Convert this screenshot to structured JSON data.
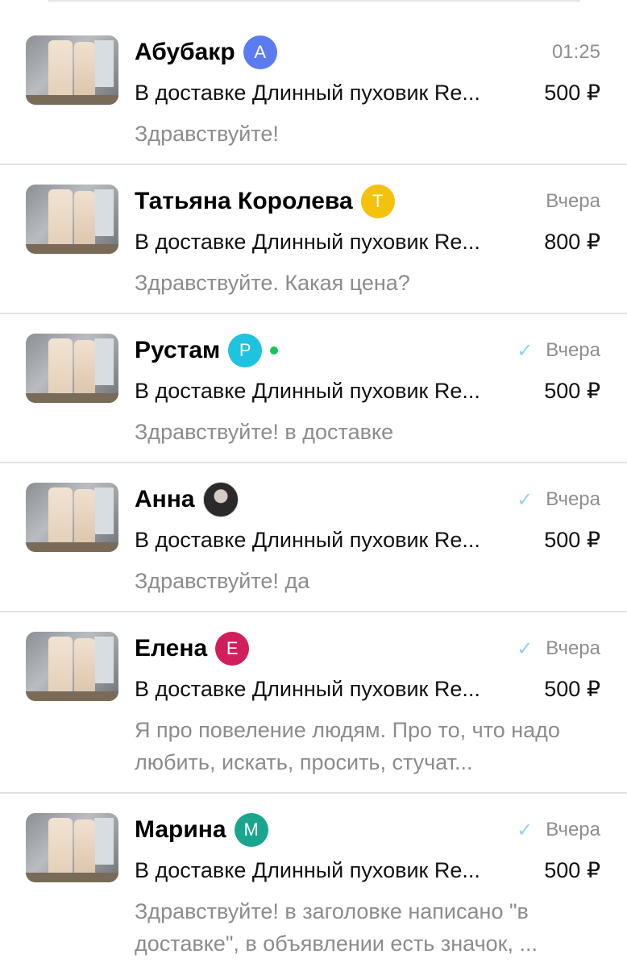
{
  "chats": [
    {
      "name": "Абубакр",
      "badge_letter": "A",
      "badge_color": "#5b7cf0",
      "badge_type": "letter",
      "online": false,
      "read": false,
      "time": "01:25",
      "item_title": "В доставке Длинный пуховик Re...",
      "price": "500 ₽",
      "message": "Здравствуйте!"
    },
    {
      "name": "Татьяна Королева",
      "badge_letter": "T",
      "badge_color": "#f4c20d",
      "badge_type": "letter",
      "online": false,
      "read": false,
      "time": "Вчера",
      "item_title": "В доставке Длинный пуховик Re...",
      "price": "800 ₽",
      "message": "Здравствуйте. Какая цена?"
    },
    {
      "name": "Рустам",
      "badge_letter": "P",
      "badge_color": "#1ec3e0",
      "badge_type": "letter",
      "online": true,
      "read": true,
      "time": "Вчера",
      "item_title": "В доставке Длинный пуховик Re...",
      "price": "500 ₽",
      "message": "Здравствуйте! в доставке"
    },
    {
      "name": "Анна",
      "badge_type": "photo",
      "online": false,
      "read": true,
      "time": "Вчера",
      "item_title": "В доставке Длинный пуховик Re...",
      "price": "500 ₽",
      "message": "Здравствуйте! да"
    },
    {
      "name": "Елена",
      "badge_letter": "E",
      "badge_color": "#d11f5c",
      "badge_type": "letter",
      "online": false,
      "read": true,
      "time": "Вчера",
      "item_title": "В доставке Длинный пуховик Re...",
      "price": "500 ₽",
      "message": "Я про повеление людям. Про то, что надо любить, искать, просить, стучат..."
    },
    {
      "name": "Марина",
      "badge_letter": "M",
      "badge_color": "#1aa58f",
      "badge_type": "letter",
      "online": false,
      "read": true,
      "time": "Вчера",
      "item_title": "В доставке Длинный пуховик Re...",
      "price": "500 ₽",
      "message": "Здравствуйте! в заголовке написано \"в доставке\", в объявлении есть значок, ..."
    }
  ],
  "icons": {
    "read_check": "✓"
  }
}
